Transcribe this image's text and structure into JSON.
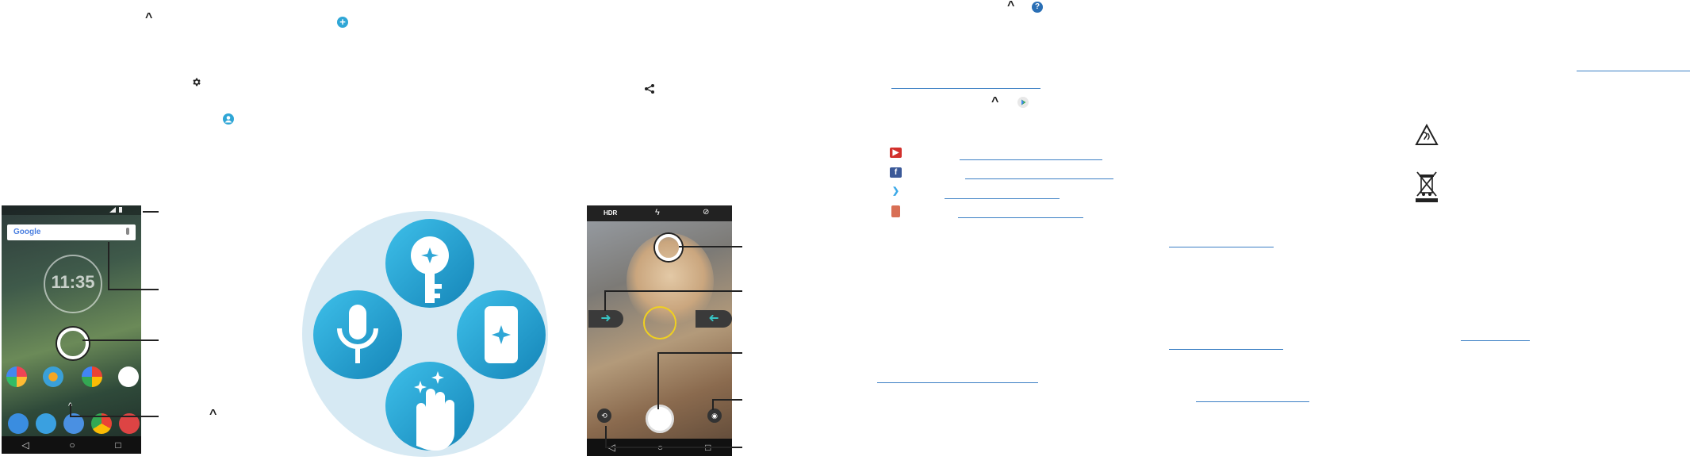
{
  "phone1": {
    "search_brand": "Google",
    "clock_time": "11:35"
  },
  "camera": {
    "hdr_label": "HDR"
  },
  "icons": {
    "chevron": "chevron-up-icon",
    "add": "add-circle-icon",
    "settings": "gear-icon",
    "account": "account-circle-icon",
    "share": "share-icon",
    "help": "help-circle-icon",
    "play": "play-store-icon"
  },
  "colors": {
    "accent": "#2fa6d6",
    "link": "#3b7fc4",
    "circle_bg": "#d6e9f3",
    "youtube": "#d2302c",
    "facebook": "#3b5998",
    "twitter": "#3ba9e8",
    "gplus": "#d86f55"
  }
}
